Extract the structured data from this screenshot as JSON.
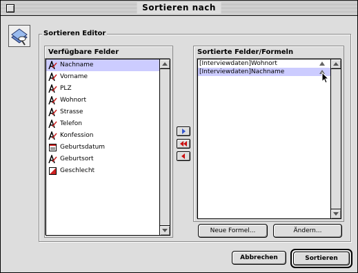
{
  "window": {
    "title": "Sortieren nach"
  },
  "editor": {
    "group_label": "Sortieren Editor"
  },
  "available": {
    "title": "Verfügbare Felder",
    "fields": [
      {
        "label": "Nachname",
        "icon": "text-field-icon",
        "selected": true
      },
      {
        "label": "Vorname",
        "icon": "text-field-icon",
        "selected": false
      },
      {
        "label": "PLZ",
        "icon": "text-field-icon",
        "selected": false
      },
      {
        "label": "Wohnort",
        "icon": "text-field-icon",
        "selected": false
      },
      {
        "label": "Strasse",
        "icon": "text-field-icon",
        "selected": false
      },
      {
        "label": "Telefon",
        "icon": "text-field-icon",
        "selected": false
      },
      {
        "label": "Konfession",
        "icon": "text-field-icon",
        "selected": false
      },
      {
        "label": "Geburtsdatum",
        "icon": "date-field-icon",
        "selected": false
      },
      {
        "label": "Geburtsort",
        "icon": "text-field-icon",
        "selected": false
      },
      {
        "label": "Geschlecht",
        "icon": "boolean-field-icon",
        "selected": false
      }
    ]
  },
  "sorted": {
    "title": "Sortierte Felder/Formeln",
    "fields": [
      {
        "label": "[Interviewdaten]Wohnort",
        "direction": "ascending",
        "selected": false
      },
      {
        "label": "[Interviewdaten]Nachname",
        "direction": "ascending",
        "selected": true
      }
    ],
    "new_formula_label": "Neue Formel...",
    "change_label": "Ändern..."
  },
  "buttons": {
    "cancel_label": "Abbrechen",
    "sort_label": "Sortieren"
  },
  "colors": {
    "selection": "#ccccff",
    "arrow_blue": "#3355cc",
    "arrow_red": "#cc1111",
    "background": "#dddddd"
  }
}
